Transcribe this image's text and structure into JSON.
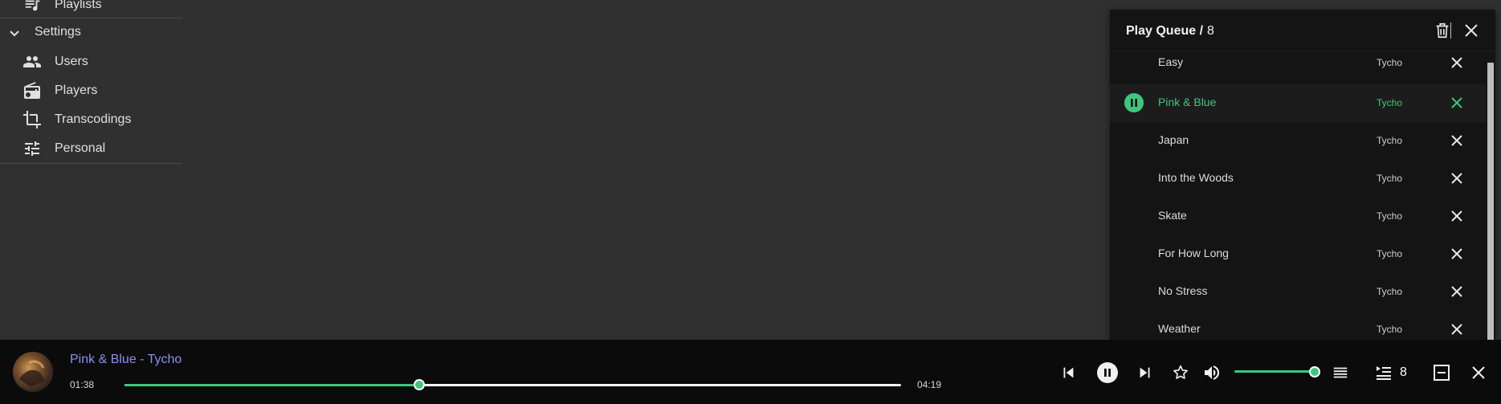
{
  "sidebar": {
    "items": [
      {
        "label": "Playlists",
        "icon": "playlist-music-icon"
      },
      {
        "label": "Settings",
        "icon": "chevron-down-icon"
      },
      {
        "label": "Users",
        "icon": "people-icon"
      },
      {
        "label": "Players",
        "icon": "radio-icon"
      },
      {
        "label": "Transcodings",
        "icon": "crop-icon"
      },
      {
        "label": "Personal",
        "icon": "tune-icon"
      }
    ]
  },
  "queue": {
    "title": "Play Queue /",
    "count": "8",
    "tracks": [
      {
        "title": "Easy",
        "artist": "Tycho",
        "playing": false
      },
      {
        "title": "Pink & Blue",
        "artist": "Tycho",
        "playing": true
      },
      {
        "title": "Japan",
        "artist": "Tycho",
        "playing": false
      },
      {
        "title": "Into the Woods",
        "artist": "Tycho",
        "playing": false
      },
      {
        "title": "Skate",
        "artist": "Tycho",
        "playing": false
      },
      {
        "title": "For How Long",
        "artist": "Tycho",
        "playing": false
      },
      {
        "title": "No Stress",
        "artist": "Tycho",
        "playing": false
      },
      {
        "title": "Weather",
        "artist": "Tycho",
        "playing": false
      }
    ]
  },
  "player": {
    "track": "Pink & Blue - Tycho",
    "elapsed": "01:38",
    "duration": "04:19",
    "progress_fraction": 0.38,
    "volume_fraction": 1.0,
    "queue_count": "8"
  },
  "colors": {
    "accent": "#3ec77c",
    "track_link": "#8b8ff0",
    "background": "#303030",
    "panel": "#141414",
    "player_bar": "#0b0b0b"
  }
}
